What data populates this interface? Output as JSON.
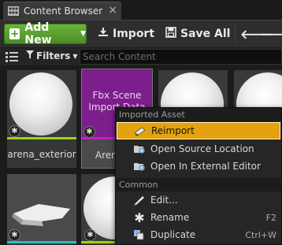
{
  "tab": {
    "title": "Content Browser",
    "close": "×"
  },
  "toolbar": {
    "add_new": "Add New",
    "import": "Import",
    "save_all": "Save All",
    "back": "🡐",
    "forward": "🡒"
  },
  "filterbar": {
    "filters": "Filters",
    "search_placeholder": "Search Content"
  },
  "assets": [
    {
      "name": "arena_exterior",
      "bar_color": "#9ad60a"
    },
    {
      "name": "Arena",
      "thumb_text": "Fbx Scene Import Data",
      "bar_color": "#c51fc8"
    },
    {
      "name": "",
      "bar_color": "#9ad60a"
    },
    {
      "name": "",
      "bar_color": "#9ad60a"
    },
    {
      "name": "",
      "bar_color": "#26c0c6"
    },
    {
      "name": "",
      "bar_color": "#9ad60a"
    }
  ],
  "context_menu": {
    "imported_asset_section": "Imported Asset",
    "reimport": "Reimport",
    "open_source_location": "Open Source Location",
    "open_in_external_editor": "Open In External Editor",
    "common_section": "Common",
    "edit": "Edit...",
    "rename": "Rename",
    "rename_shortcut": "F2",
    "duplicate": "Duplicate",
    "duplicate_shortcut": "Ctrl+W"
  }
}
